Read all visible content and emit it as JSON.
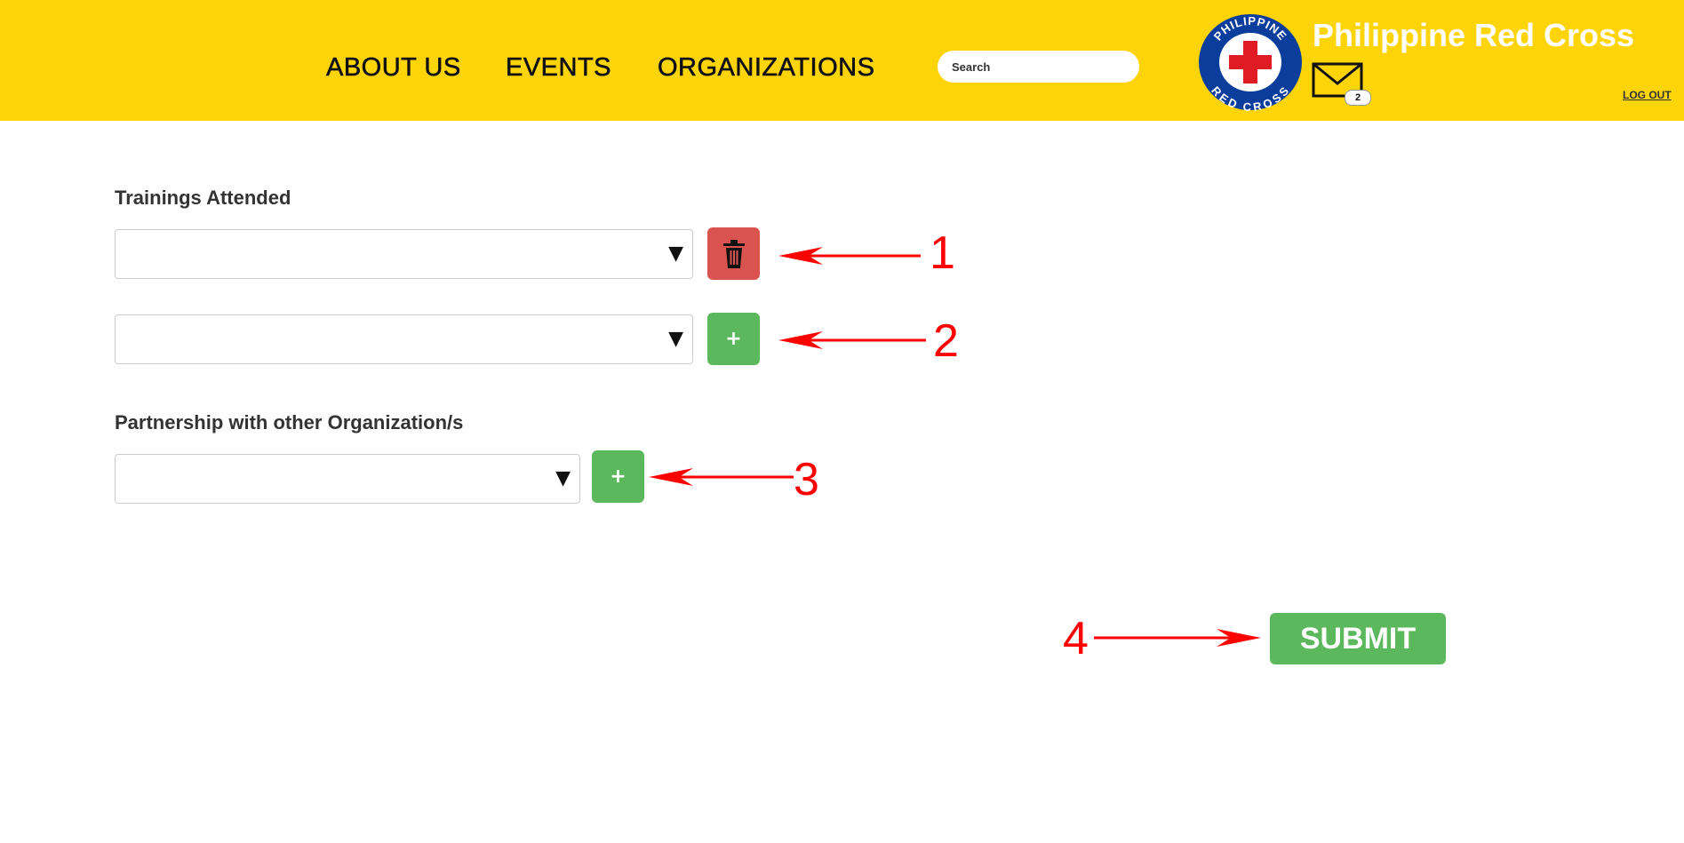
{
  "nav": {
    "about": "ABOUT US",
    "events": "EVENTS",
    "organizations": "ORGANIZATIONS"
  },
  "search": {
    "placeholder": "Search",
    "value": ""
  },
  "brand": {
    "name": "Philippine Red Cross",
    "logo_top_text": "PHILIPPINE",
    "logo_bottom_text": "RED CROSS"
  },
  "mail": {
    "badge_count": "2"
  },
  "logout_label": "LOG OUT",
  "trainings": {
    "label": "Trainings Attended",
    "rows": [
      {
        "value": "",
        "action": "delete"
      },
      {
        "value": "",
        "action": "add"
      }
    ]
  },
  "partnership": {
    "label": "Partnership with other Organization/s",
    "rows": [
      {
        "value": "",
        "action": "add"
      }
    ]
  },
  "submit_label": "SUBMIT",
  "annotations": [
    "1",
    "2",
    "3",
    "4"
  ],
  "colors": {
    "header_bg": "#fcd408",
    "delete_button": "#d9534f",
    "add_button": "#5cb85c",
    "submit_button": "#5cb85c",
    "annotation": "#ff0000",
    "logo_blue": "#0a3d9c",
    "logo_red": "#e01b24"
  },
  "icons": {
    "caret": "caret-down-icon",
    "delete": "trash-icon",
    "add": "plus-icon",
    "mail": "envelope-icon"
  }
}
